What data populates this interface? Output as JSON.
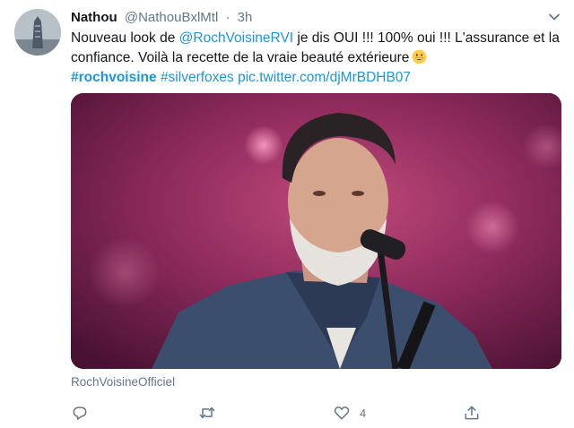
{
  "tweet": {
    "display_name": "Nathou",
    "handle": "@NathouBxlMtl",
    "separator": "·",
    "time": "3h",
    "text": {
      "part1": "Nouveau look de ",
      "mention": "@RochVoisineRVI",
      "part2": " je dis OUI !!! 100% oui !!! L'assurance et la confiance. Voilà la recette de la vraie beauté extérieure",
      "hashtag1": "#rochvoisine",
      "hashtag2": "#silverfoxes",
      "pic_link": "pic.twitter.com/djMrBDHB07"
    },
    "emoji": "grinning-face-emoji",
    "media_source": "RochVoisineOfficiel"
  },
  "actions": {
    "reply": {
      "icon": "reply-icon",
      "count": ""
    },
    "retweet": {
      "icon": "retweet-icon",
      "count": ""
    },
    "like": {
      "icon": "heart-icon",
      "count": "4"
    },
    "share": {
      "icon": "share-icon",
      "count": ""
    }
  },
  "colors": {
    "text": "#14171a",
    "secondary": "#657786",
    "link": "#1b95e0",
    "background": "#ffffff"
  }
}
